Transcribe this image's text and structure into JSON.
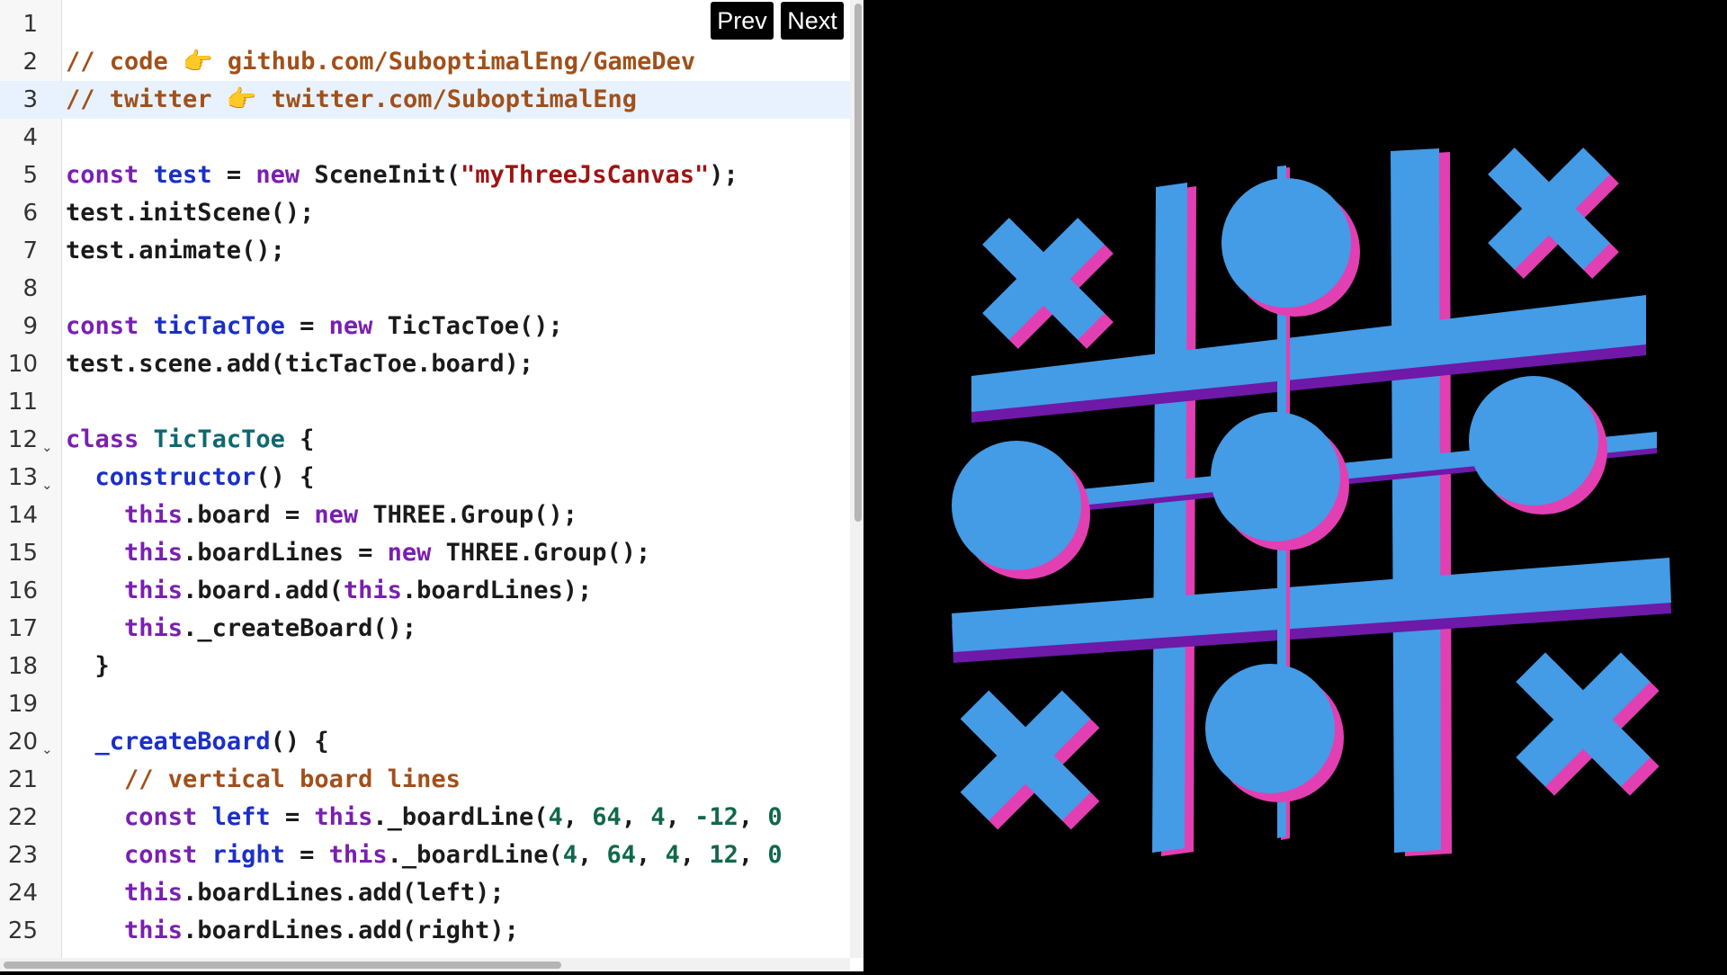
{
  "nav": {
    "prev_label": "Prev",
    "next_label": "Next"
  },
  "colors": {
    "comment": "#a1501a",
    "keyword": "#7a1fb0",
    "definition": "#1a2fc8",
    "string": "#a01313",
    "number": "#11684a",
    "class_name": "#0e6870",
    "board_top": "#449be6",
    "board_side_pink": "#e23fb3",
    "board_side_purple": "#6e19a8",
    "piece_edge_yellow": "#d9d98a",
    "canvas_bg": "#000000"
  },
  "editor": {
    "active_line": 3,
    "lines": [
      {
        "n": "1",
        "fold": false,
        "tokens": []
      },
      {
        "n": "2",
        "fold": false,
        "tokens": [
          [
            "comment",
            "// code 👉 github.com/SuboptimalEng/GameDev"
          ]
        ]
      },
      {
        "n": "3",
        "fold": false,
        "tokens": [
          [
            "comment",
            "// twitter 👉 twitter.com/SuboptimalEng"
          ]
        ]
      },
      {
        "n": "4",
        "fold": false,
        "tokens": []
      },
      {
        "n": "5",
        "fold": false,
        "tokens": [
          [
            "keyword",
            "const"
          ],
          [
            "plain",
            " "
          ],
          [
            "def",
            "test"
          ],
          [
            "plain",
            " = "
          ],
          [
            "keyword",
            "new"
          ],
          [
            "plain",
            " SceneInit("
          ],
          [
            "string",
            "\"myThreeJsCanvas\""
          ],
          [
            "plain",
            ");"
          ]
        ]
      },
      {
        "n": "6",
        "fold": false,
        "tokens": [
          [
            "plain",
            "test.initScene();"
          ]
        ]
      },
      {
        "n": "7",
        "fold": false,
        "tokens": [
          [
            "plain",
            "test.animate();"
          ]
        ]
      },
      {
        "n": "8",
        "fold": false,
        "tokens": []
      },
      {
        "n": "9",
        "fold": false,
        "tokens": [
          [
            "keyword",
            "const"
          ],
          [
            "plain",
            " "
          ],
          [
            "def",
            "ticTacToe"
          ],
          [
            "plain",
            " = "
          ],
          [
            "keyword",
            "new"
          ],
          [
            "plain",
            " TicTacToe();"
          ]
        ]
      },
      {
        "n": "10",
        "fold": false,
        "tokens": [
          [
            "plain",
            "test.scene.add(ticTacToe.board);"
          ]
        ]
      },
      {
        "n": "11",
        "fold": false,
        "tokens": []
      },
      {
        "n": "12",
        "fold": true,
        "tokens": [
          [
            "keyword",
            "class"
          ],
          [
            "plain",
            " "
          ],
          [
            "class",
            "TicTacToe"
          ],
          [
            "plain",
            " {"
          ]
        ]
      },
      {
        "n": "13",
        "fold": true,
        "tokens": [
          [
            "plain",
            "  "
          ],
          [
            "def",
            "constructor"
          ],
          [
            "plain",
            "() {"
          ]
        ]
      },
      {
        "n": "14",
        "fold": false,
        "tokens": [
          [
            "plain",
            "    "
          ],
          [
            "keyword",
            "this"
          ],
          [
            "plain",
            ".board = "
          ],
          [
            "keyword",
            "new"
          ],
          [
            "plain",
            " THREE.Group();"
          ]
        ]
      },
      {
        "n": "15",
        "fold": false,
        "tokens": [
          [
            "plain",
            "    "
          ],
          [
            "keyword",
            "this"
          ],
          [
            "plain",
            ".boardLines = "
          ],
          [
            "keyword",
            "new"
          ],
          [
            "plain",
            " THREE.Group();"
          ]
        ]
      },
      {
        "n": "16",
        "fold": false,
        "tokens": [
          [
            "plain",
            "    "
          ],
          [
            "keyword",
            "this"
          ],
          [
            "plain",
            ".board.add("
          ],
          [
            "keyword",
            "this"
          ],
          [
            "plain",
            ".boardLines);"
          ]
        ]
      },
      {
        "n": "17",
        "fold": false,
        "tokens": [
          [
            "plain",
            "    "
          ],
          [
            "keyword",
            "this"
          ],
          [
            "plain",
            "._createBoard();"
          ]
        ]
      },
      {
        "n": "18",
        "fold": false,
        "tokens": [
          [
            "plain",
            "  }"
          ]
        ]
      },
      {
        "n": "19",
        "fold": false,
        "tokens": []
      },
      {
        "n": "20",
        "fold": true,
        "tokens": [
          [
            "plain",
            "  "
          ],
          [
            "def",
            "_createBoard"
          ],
          [
            "plain",
            "() {"
          ]
        ]
      },
      {
        "n": "21",
        "fold": false,
        "tokens": [
          [
            "plain",
            "    "
          ],
          [
            "comment",
            "// vertical board lines"
          ]
        ]
      },
      {
        "n": "22",
        "fold": false,
        "tokens": [
          [
            "plain",
            "    "
          ],
          [
            "keyword",
            "const"
          ],
          [
            "plain",
            " "
          ],
          [
            "def",
            "left"
          ],
          [
            "plain",
            " = "
          ],
          [
            "keyword",
            "this"
          ],
          [
            "plain",
            "._boardLine("
          ],
          [
            "number",
            "4"
          ],
          [
            "plain",
            ", "
          ],
          [
            "number",
            "64"
          ],
          [
            "plain",
            ", "
          ],
          [
            "number",
            "4"
          ],
          [
            "plain",
            ", "
          ],
          [
            "number",
            "-12"
          ],
          [
            "plain",
            ", "
          ],
          [
            "number",
            "0"
          ]
        ]
      },
      {
        "n": "23",
        "fold": false,
        "tokens": [
          [
            "plain",
            "    "
          ],
          [
            "keyword",
            "const"
          ],
          [
            "plain",
            " "
          ],
          [
            "def",
            "right"
          ],
          [
            "plain",
            " = "
          ],
          [
            "keyword",
            "this"
          ],
          [
            "plain",
            "._boardLine("
          ],
          [
            "number",
            "4"
          ],
          [
            "plain",
            ", "
          ],
          [
            "number",
            "64"
          ],
          [
            "plain",
            ", "
          ],
          [
            "number",
            "4"
          ],
          [
            "plain",
            ", "
          ],
          [
            "number",
            "12"
          ],
          [
            "plain",
            ", "
          ],
          [
            "number",
            "0"
          ]
        ]
      },
      {
        "n": "24",
        "fold": false,
        "tokens": [
          [
            "plain",
            "    "
          ],
          [
            "keyword",
            "this"
          ],
          [
            "plain",
            ".boardLines.add(left);"
          ]
        ]
      },
      {
        "n": "25",
        "fold": false,
        "tokens": [
          [
            "plain",
            "    "
          ],
          [
            "keyword",
            "this"
          ],
          [
            "plain",
            ".boardLines.add(right);"
          ]
        ]
      }
    ]
  },
  "scene": {
    "board_cells": [
      [
        "x",
        "o",
        "x"
      ],
      [
        "o",
        "o",
        "o"
      ],
      [
        "x",
        "o",
        "x"
      ]
    ]
  }
}
